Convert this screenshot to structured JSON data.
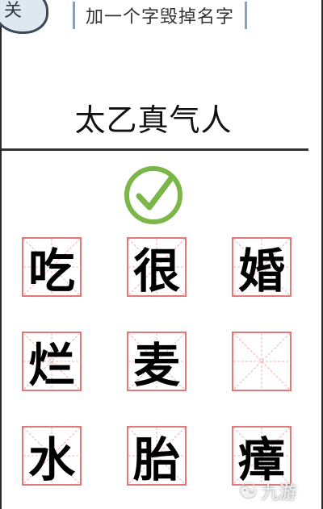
{
  "level_badge": {
    "label": "关"
  },
  "hint": {
    "text": "加一个字毁掉名字"
  },
  "answer": {
    "text": "太乙真气人"
  },
  "status": {
    "icon": "checkmark-circle-icon",
    "color": "#7ab648"
  },
  "grid": {
    "rows": [
      [
        {
          "char": "吃"
        },
        {
          "char": "很"
        },
        {
          "char": "婚"
        }
      ],
      [
        {
          "char": "烂"
        },
        {
          "char": "麦"
        },
        {
          "char": ""
        }
      ],
      [
        {
          "char": "水"
        },
        {
          "char": "胎"
        },
        {
          "char": "瘴"
        }
      ]
    ]
  },
  "watermark": {
    "icon": "jiuyou-logo-icon",
    "text": "九游"
  },
  "colors": {
    "grid_border": "#e07a7a",
    "guide_line": "#e8a0a0"
  }
}
